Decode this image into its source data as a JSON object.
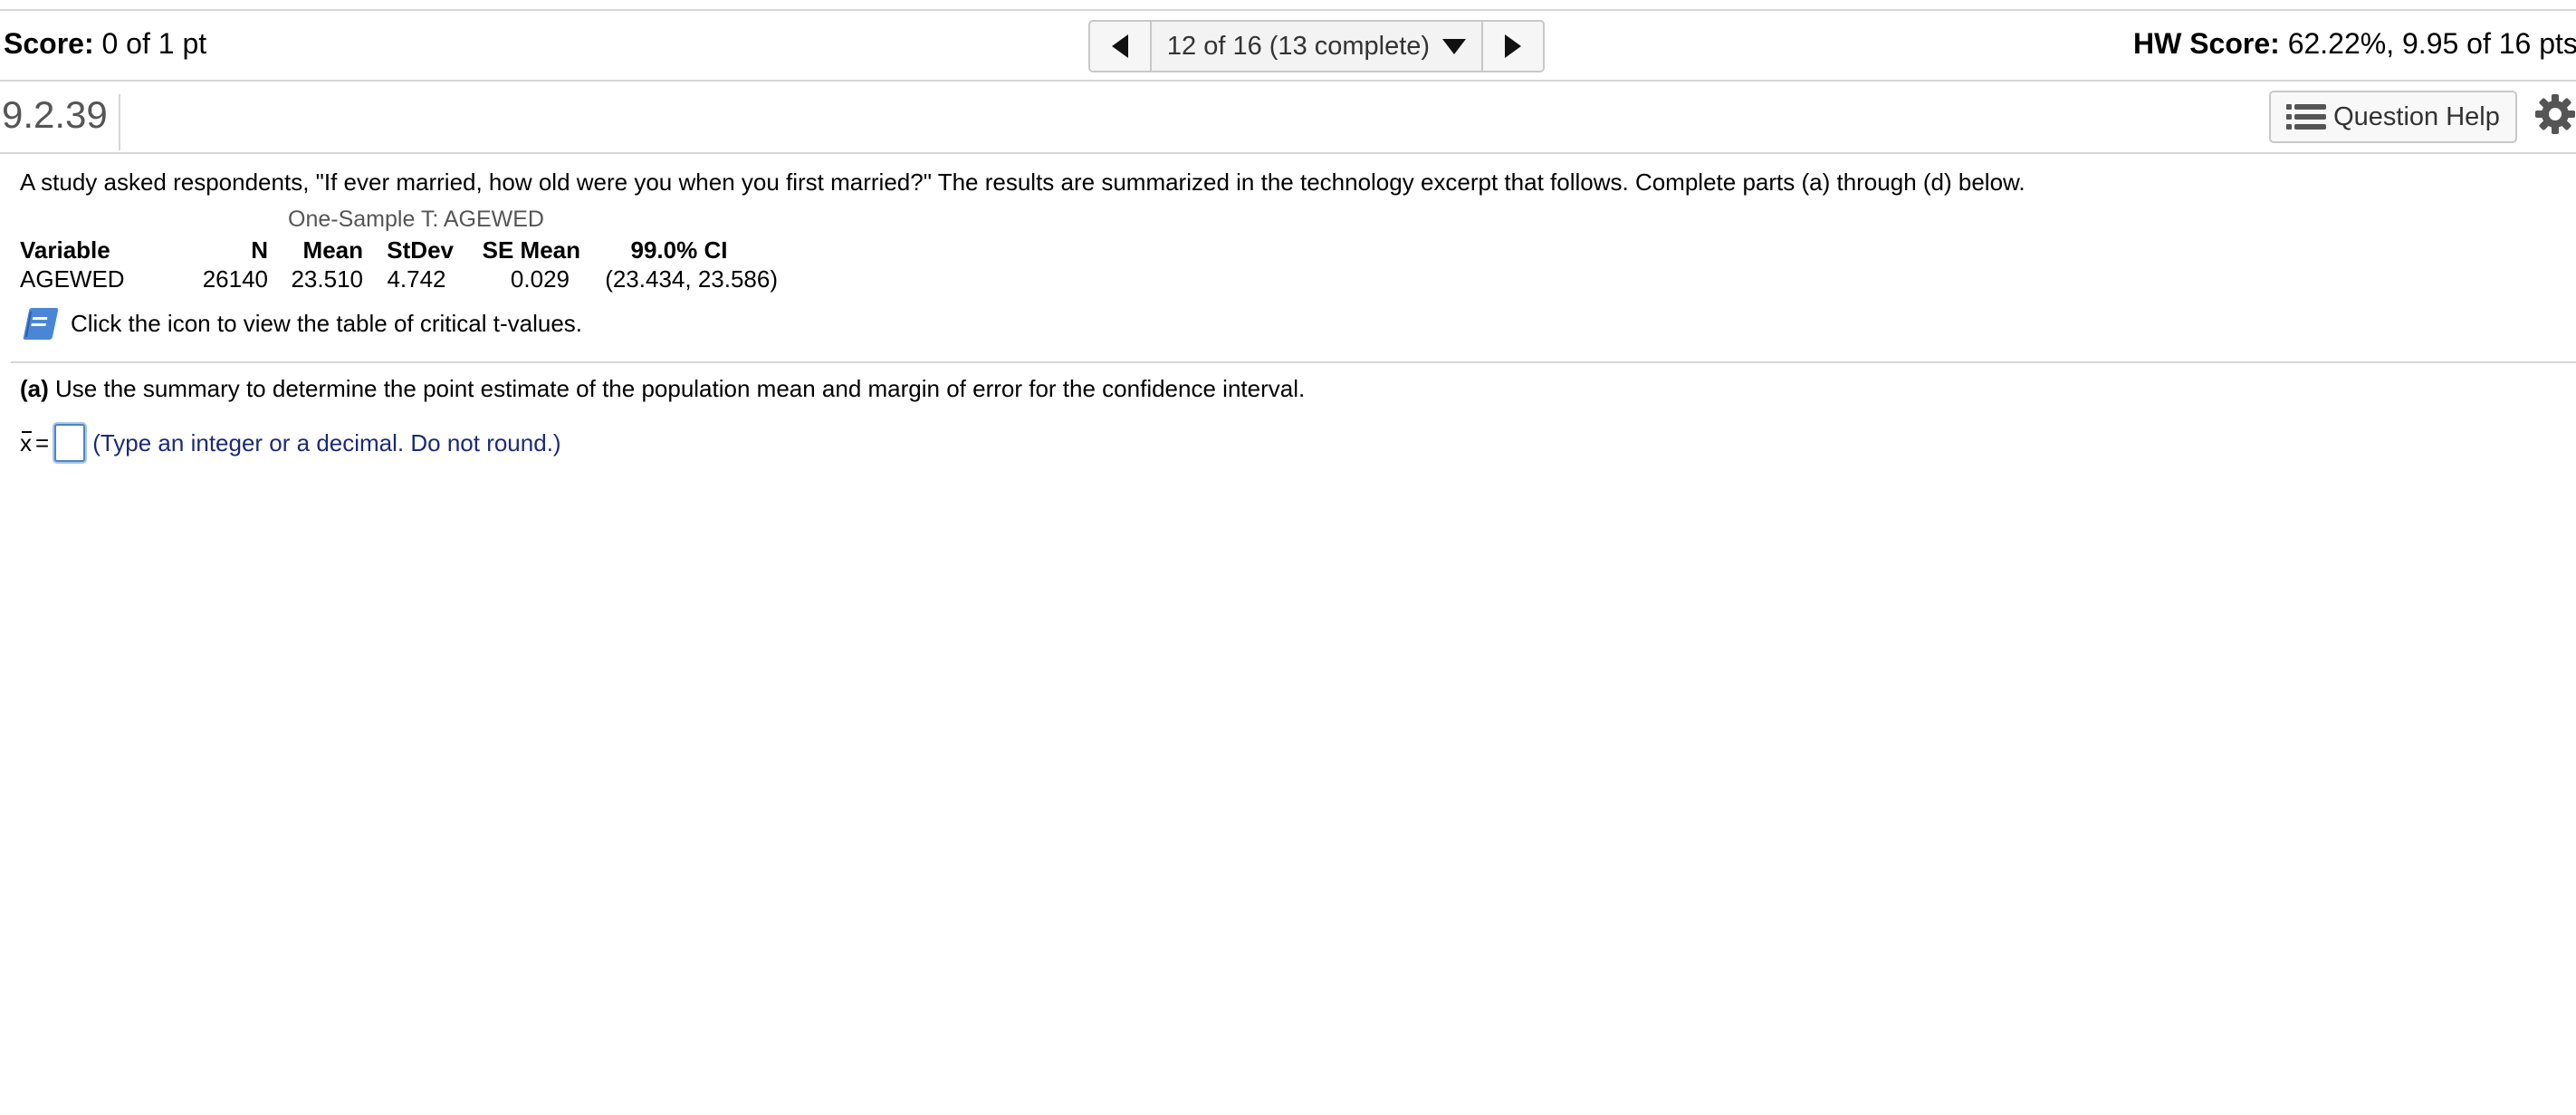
{
  "score": {
    "label": "Score:",
    "value": "0 of 1 pt"
  },
  "nav": {
    "selector_text": "12 of 16 (13 complete)"
  },
  "hw_score": {
    "label": "HW Score:",
    "value": "62.22%, 9.95 of 16 pts"
  },
  "question": {
    "number": "9.2.39",
    "help_label": "Question Help"
  },
  "content": {
    "intro": "A study asked respondents, \"If ever married, how old were you when you first married?\" The results are summarized in the technology excerpt that follows. Complete parts (a) through (d) below.",
    "tech_title": "One-Sample T: AGEWED",
    "table": {
      "headers": [
        "Variable",
        "N",
        "Mean",
        "StDev",
        "SE Mean",
        "99.0% CI"
      ],
      "row": [
        "AGEWED",
        "26140",
        "23.510",
        "4.742",
        "0.029",
        "(23.434, 23.586)"
      ]
    },
    "reference_text": "Click the icon to view the table of critical t-values.",
    "part_a_label": "(a)",
    "part_a_text": "Use the summary to determine the point estimate of the population mean and margin of error for the confidence interval.",
    "answer_symbol": "x",
    "answer_equals": "=",
    "answer_value": "",
    "answer_hint": "(Type an integer or a decimal. Do not round.)"
  },
  "icons": {
    "prev": "triangle-left-icon",
    "next": "triangle-right-icon",
    "dropdown": "triangle-down-icon",
    "help": "list-icon",
    "settings": "gear-icon",
    "reference": "book-icon"
  }
}
